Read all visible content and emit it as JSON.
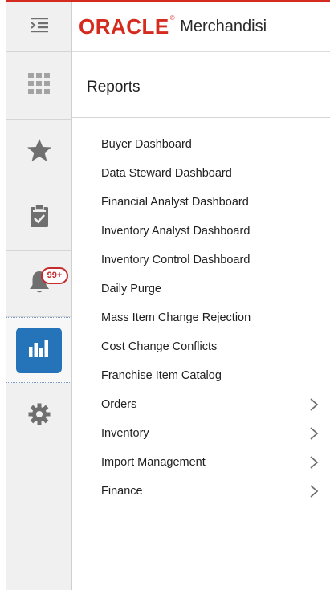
{
  "app": {
    "brand": "ORACLE",
    "product_name": "Merchandisi"
  },
  "sidebar": {
    "items": [
      {
        "name": "menu-toggle",
        "icon": "menu-indent-icon"
      },
      {
        "name": "apps",
        "icon": "apps-grid-icon"
      },
      {
        "name": "favorites",
        "icon": "star-icon"
      },
      {
        "name": "tasks",
        "icon": "clipboard-check-icon"
      },
      {
        "name": "notifications",
        "icon": "bell-icon",
        "badge": "99+"
      },
      {
        "name": "reports",
        "icon": "bar-chart-icon",
        "active": true
      },
      {
        "name": "settings",
        "icon": "gear-icon"
      }
    ]
  },
  "panel": {
    "title": "Reports",
    "items": [
      {
        "label": "Buyer Dashboard",
        "submenu": false
      },
      {
        "label": "Data Steward Dashboard",
        "submenu": false
      },
      {
        "label": "Financial Analyst Dashboard",
        "submenu": false
      },
      {
        "label": "Inventory Analyst Dashboard",
        "submenu": false
      },
      {
        "label": "Inventory Control Dashboard",
        "submenu": false
      },
      {
        "label": "Daily Purge",
        "submenu": false
      },
      {
        "label": "Mass Item Change Rejection",
        "submenu": false
      },
      {
        "label": "Cost Change Conflicts",
        "submenu": false
      },
      {
        "label": "Franchise Item Catalog",
        "submenu": false
      },
      {
        "label": "Orders",
        "submenu": true
      },
      {
        "label": "Inventory",
        "submenu": true
      },
      {
        "label": "Import Management",
        "submenu": true
      },
      {
        "label": "Finance",
        "submenu": true
      }
    ]
  },
  "colors": {
    "oracle_red": "#d52b1e",
    "active_blue": "#2573b8",
    "sidebar_bg": "#f0f0f0",
    "icon_gray": "#6f6f6f"
  }
}
